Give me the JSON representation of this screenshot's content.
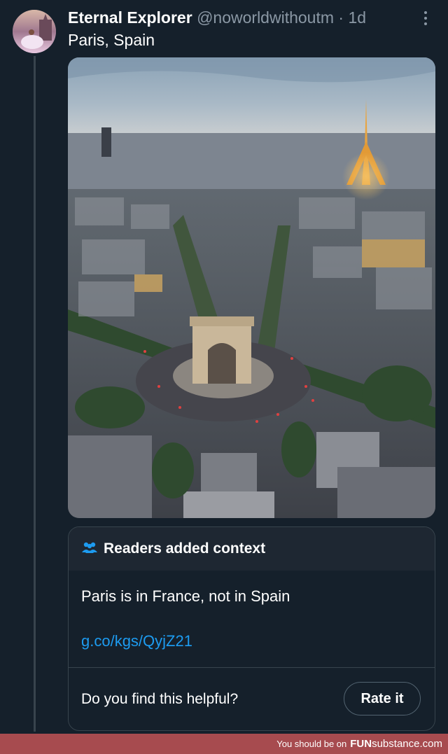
{
  "post": {
    "display_name": "Eternal Explorer",
    "handle": "@noworldwithoutm",
    "separator": "·",
    "age": "1d",
    "text": "Paris, Spain"
  },
  "icons": {
    "more": "more-vertical-icon",
    "readers": "people-icon"
  },
  "community_note": {
    "title": "Readers added context",
    "body": "Paris is in France, not in Spain",
    "link": "g.co/kgs/QyjZ21",
    "question": "Do you find this helpful?",
    "button": "Rate it"
  },
  "watermark": {
    "prefix": "You should be on",
    "brand_a": "FUN",
    "brand_b": "substance",
    "suffix": ".com"
  },
  "colors": {
    "background": "#15202b",
    "accent_link": "#1d9bf0",
    "muted": "#8b98a5",
    "watermark_bar": "#a74b4f"
  }
}
